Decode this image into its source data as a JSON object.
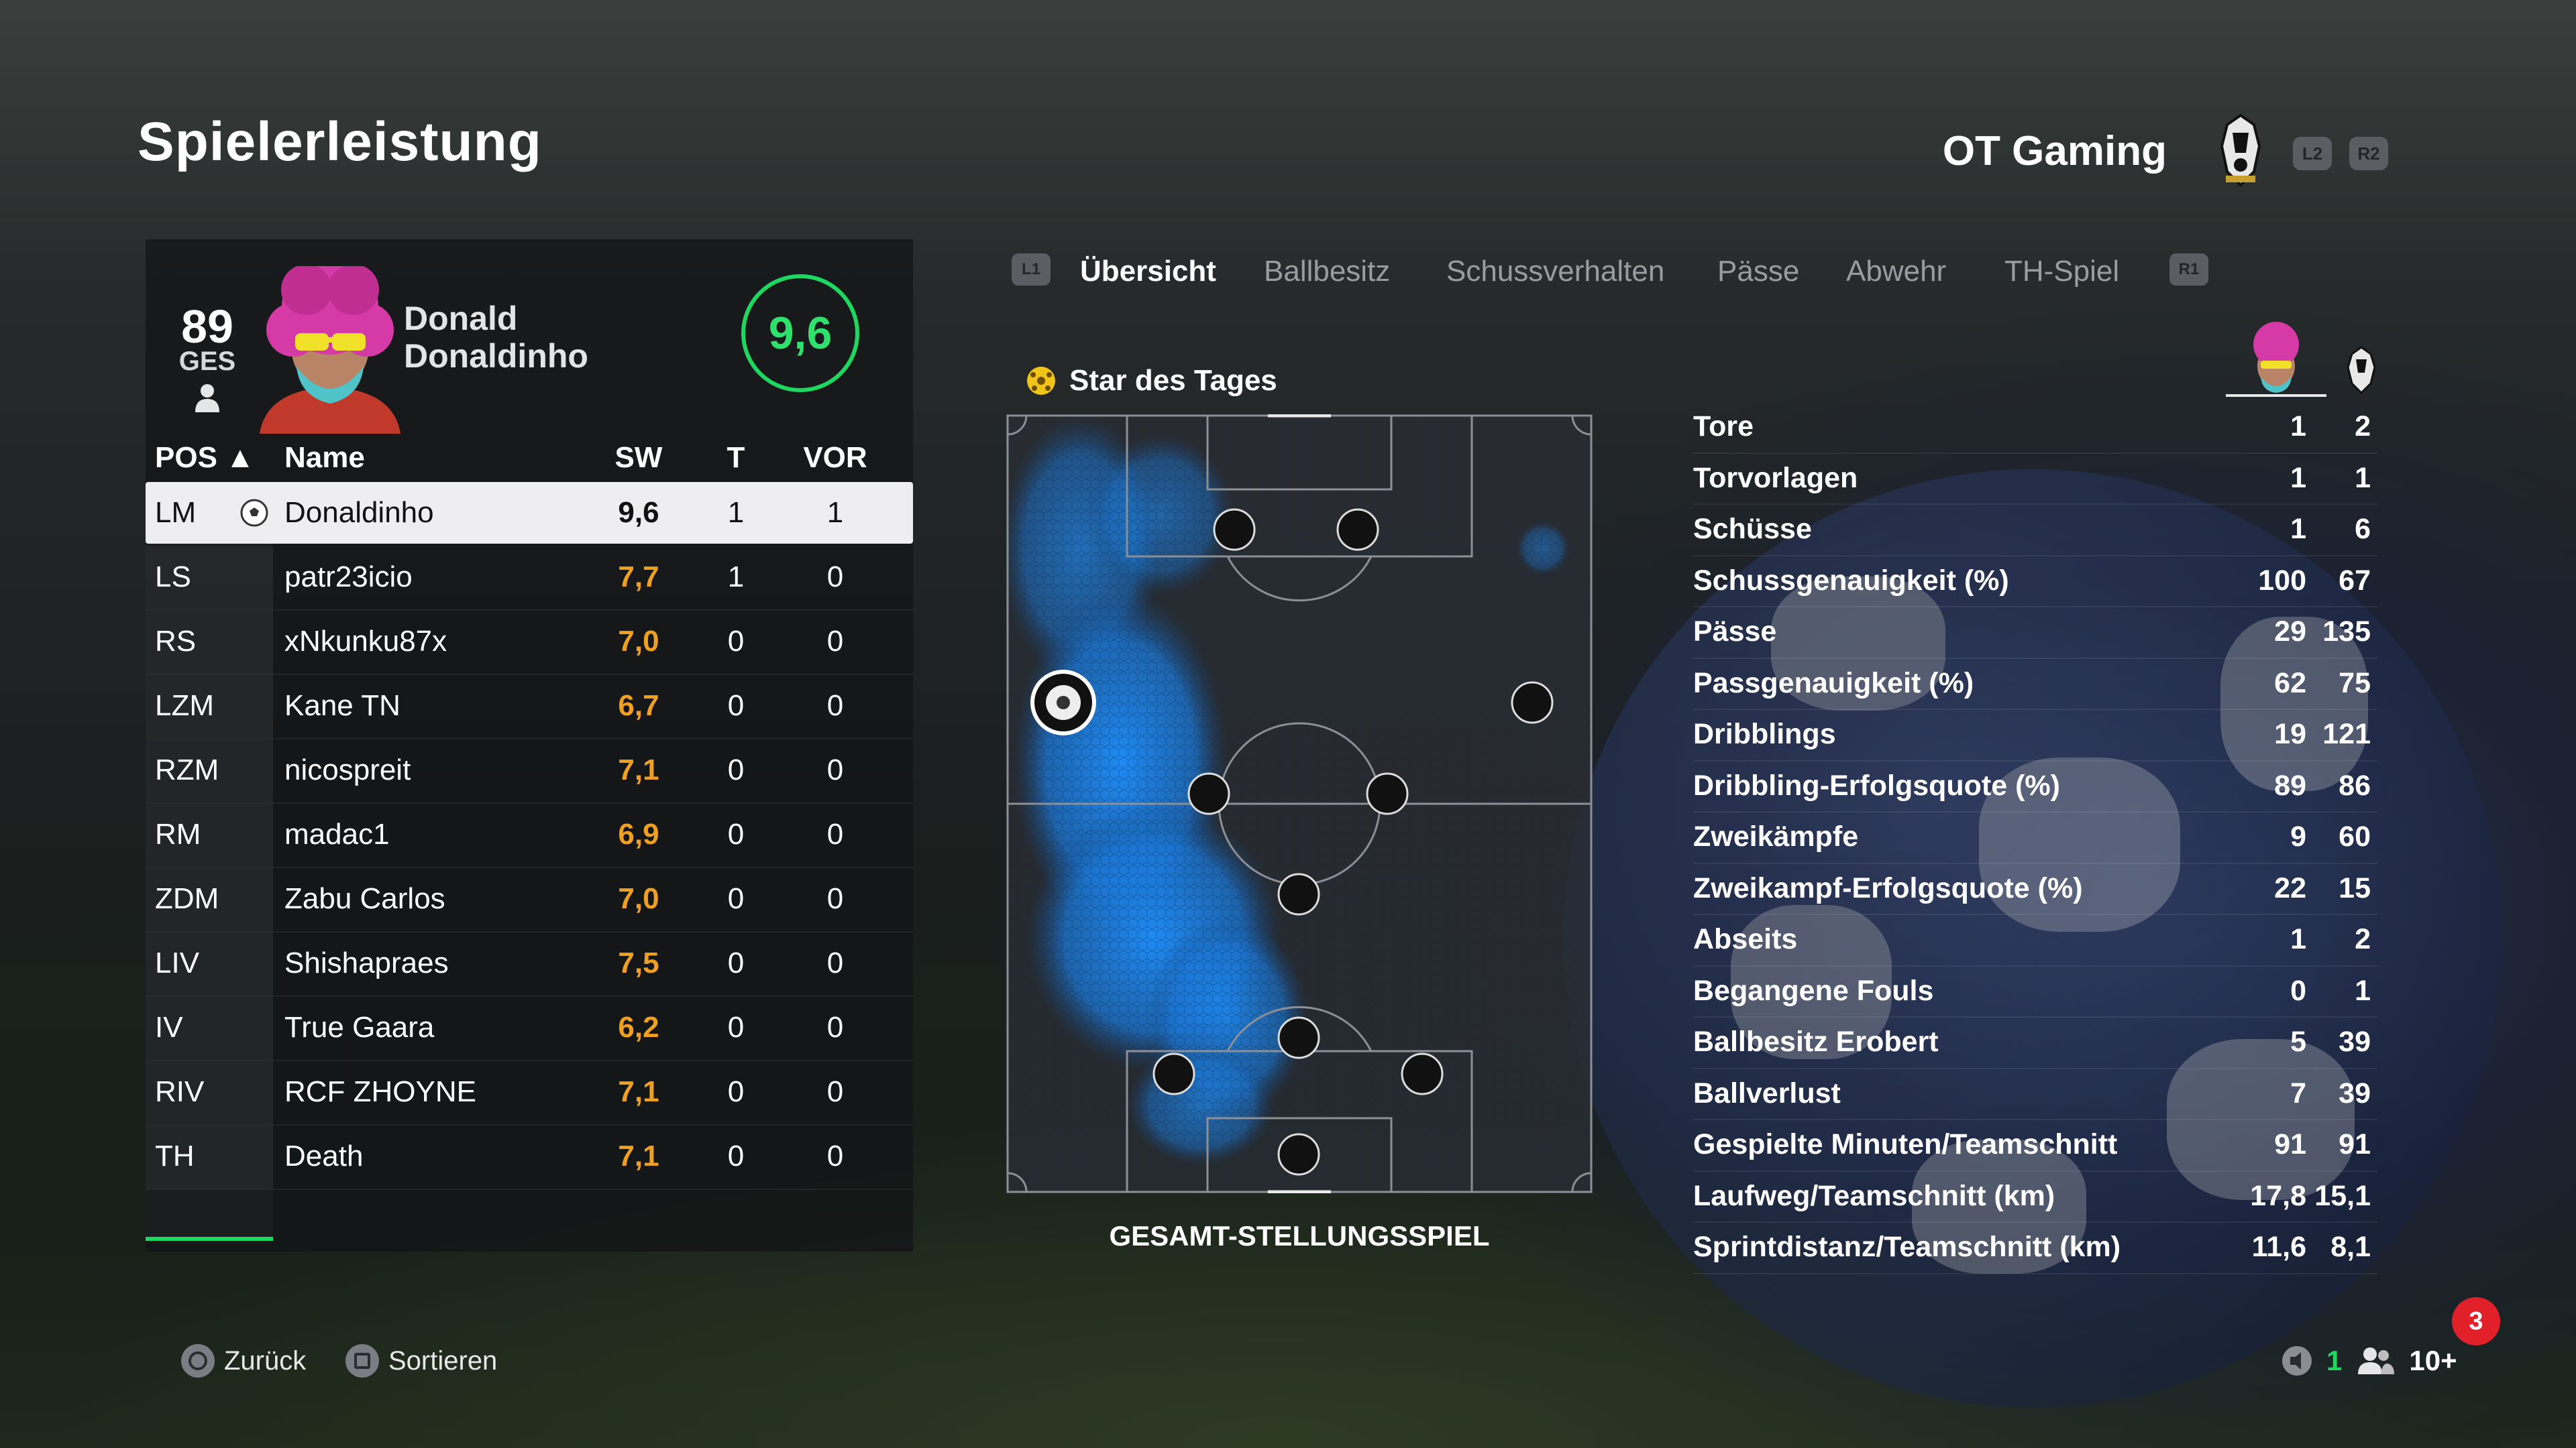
{
  "header": {
    "title": "Spielerleistung",
    "team_name": "OT Gaming",
    "btn_l2": "L2",
    "btn_r2": "R2"
  },
  "player": {
    "overall": "89",
    "overall_label": "GES",
    "first_name": "Donald",
    "last_name": "Donaldinho",
    "match_rating": "9,6"
  },
  "table": {
    "headers": {
      "pos": "POS ▲",
      "name": "Name",
      "sw": "SW",
      "t": "T",
      "vor": "VOR"
    },
    "rows": [
      {
        "pos": "LM",
        "name": "Donaldinho",
        "sw": "9,6",
        "t": "1",
        "vor": "1",
        "selected": true
      },
      {
        "pos": "LS",
        "name": "patr23icio",
        "sw": "7,7",
        "t": "1",
        "vor": "0"
      },
      {
        "pos": "RS",
        "name": "xNkunku87x",
        "sw": "7,0",
        "t": "0",
        "vor": "0"
      },
      {
        "pos": "LZM",
        "name": "Kane TN",
        "sw": "6,7",
        "t": "0",
        "vor": "0"
      },
      {
        "pos": "RZM",
        "name": "nicospreit",
        "sw": "7,1",
        "t": "0",
        "vor": "0"
      },
      {
        "pos": "RM",
        "name": "madac1",
        "sw": "6,9",
        "t": "0",
        "vor": "0"
      },
      {
        "pos": "ZDM",
        "name": "Zabu Carlos",
        "sw": "7,0",
        "t": "0",
        "vor": "0"
      },
      {
        "pos": "LIV",
        "name": "Shishapraes",
        "sw": "7,5",
        "t": "0",
        "vor": "0"
      },
      {
        "pos": "IV",
        "name": "True Gaara",
        "sw": "6,2",
        "t": "0",
        "vor": "0"
      },
      {
        "pos": "RIV",
        "name": "RCF ZHOYNE",
        "sw": "7,1",
        "t": "0",
        "vor": "0"
      },
      {
        "pos": "TH",
        "name": "Death",
        "sw": "7,1",
        "t": "0",
        "vor": "0"
      }
    ]
  },
  "tabs": {
    "left_btn": "L1",
    "right_btn": "R1",
    "items": [
      "Übersicht",
      "Ballbesitz",
      "Schussverhalten",
      "Pässe",
      "Abwehr",
      "TH-Spiel"
    ],
    "active": 0
  },
  "pitch": {
    "star_label": "Star des Tages",
    "caption": "GESAMT-STELLUNGSSPIEL"
  },
  "stats": [
    {
      "label": "Tore",
      "player": "1",
      "team": "2"
    },
    {
      "label": "Torvorlagen",
      "player": "1",
      "team": "1"
    },
    {
      "label": "Schüsse",
      "player": "1",
      "team": "6"
    },
    {
      "label": "Schussgenauigkeit (%)",
      "player": "100",
      "team": "67"
    },
    {
      "label": "Pässe",
      "player": "29",
      "team": "135"
    },
    {
      "label": "Passgenauigkeit (%)",
      "player": "62",
      "team": "75"
    },
    {
      "label": "Dribblings",
      "player": "19",
      "team": "121"
    },
    {
      "label": "Dribbling-Erfolgsquote (%)",
      "player": "89",
      "team": "86"
    },
    {
      "label": "Zweikämpfe",
      "player": "9",
      "team": "60"
    },
    {
      "label": "Zweikampf-Erfolgsquote (%)",
      "player": "22",
      "team": "15"
    },
    {
      "label": "Abseits",
      "player": "1",
      "team": "2"
    },
    {
      "label": "Begangene Fouls",
      "player": "0",
      "team": "1"
    },
    {
      "label": "Ballbesitz Erobert",
      "player": "5",
      "team": "39"
    },
    {
      "label": "Ballverlust",
      "player": "7",
      "team": "39"
    },
    {
      "label": "Gespielte Minuten/Teamschnitt",
      "player": "91",
      "team": "91"
    },
    {
      "label": "Laufweg/Teamschnitt (km)",
      "player": "17,8",
      "team": "15,1"
    },
    {
      "label": "Sprintdistanz/Teamschnitt (km)",
      "player": "11,6",
      "team": "8,1"
    }
  ],
  "footer": {
    "back_label": "Zurück",
    "sort_label": "Sortieren",
    "status_count": "1",
    "players_count": "10+",
    "notification_count": "3"
  },
  "colors": {
    "accent_green": "#1ed760",
    "rating_orange": "#f0a020",
    "heat_blue": "#1e90ff",
    "notification_red": "#e2202a"
  }
}
